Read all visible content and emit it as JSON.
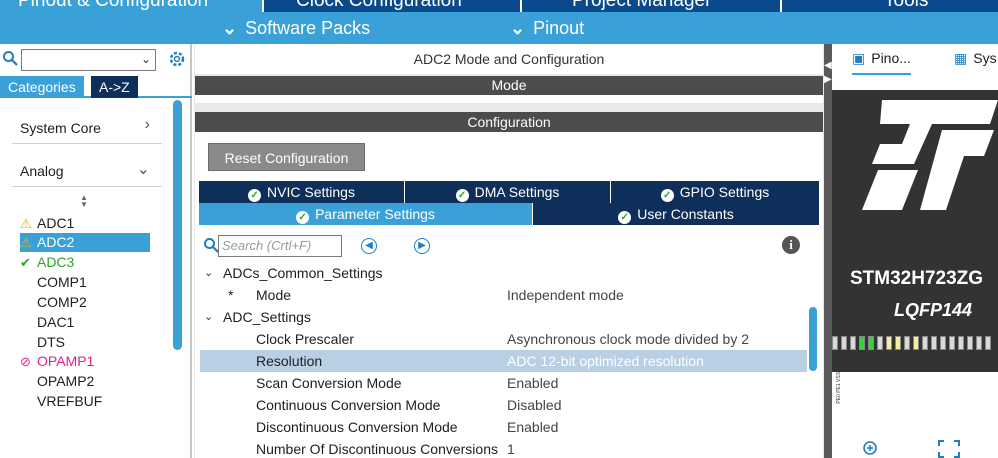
{
  "top_tabs": [
    {
      "label": "Pinout & Configuration"
    },
    {
      "label": "Clock Configuration"
    },
    {
      "label": "Project Manager"
    },
    {
      "label": "Tools"
    }
  ],
  "sub_bar": {
    "software_packs": "Software Packs",
    "pinout": "Pinout"
  },
  "left": {
    "tab_categories": "Categories",
    "tab_az": "A->Z",
    "groups": [
      {
        "label": "System Core"
      },
      {
        "label": "Analog"
      }
    ],
    "peripherals": [
      {
        "label": "ADC1",
        "status": "warning"
      },
      {
        "label": "ADC2",
        "status": "warning",
        "selected": true
      },
      {
        "label": "ADC3",
        "status": "ok"
      },
      {
        "label": "COMP1",
        "status": "none"
      },
      {
        "label": "COMP2",
        "status": "none"
      },
      {
        "label": "DAC1",
        "status": "none"
      },
      {
        "label": "DTS",
        "status": "none"
      },
      {
        "label": "OPAMP1",
        "status": "conflict"
      },
      {
        "label": "OPAMP2",
        "status": "none"
      },
      {
        "label": "VREFBUF",
        "status": "none"
      }
    ]
  },
  "middle": {
    "title": "ADC2 Mode and Configuration",
    "mode_label": "Mode",
    "configuration_label": "Configuration",
    "reset_button": "Reset Configuration",
    "tabs_row1": [
      {
        "label": "NVIC Settings"
      },
      {
        "label": "DMA Settings"
      },
      {
        "label": "GPIO Settings"
      }
    ],
    "tabs_row2": [
      {
        "label": "Parameter Settings",
        "active": true
      },
      {
        "label": "User Constants"
      }
    ],
    "search_placeholder": "Search (Crtl+F)",
    "params": [
      {
        "type": "group",
        "label": "ADCs_Common_Settings"
      },
      {
        "type": "param",
        "marker": "*",
        "name": "Mode",
        "value": "Independent mode"
      },
      {
        "type": "group",
        "label": "ADC_Settings"
      },
      {
        "type": "param",
        "name": "Clock Prescaler",
        "value": "Asynchronous clock mode divided by 2"
      },
      {
        "type": "param",
        "name": "Resolution",
        "value": "ADC 12-bit optimized resolution",
        "selected": true
      },
      {
        "type": "param",
        "name": "Scan Conversion Mode",
        "value": "Enabled"
      },
      {
        "type": "param",
        "name": "Continuous Conversion Mode",
        "value": "Disabled"
      },
      {
        "type": "param",
        "name": "Discontinuous Conversion Mode",
        "value": "Enabled"
      },
      {
        "type": "param",
        "name": "Number Of Discontinuous Conversions",
        "value": "1"
      }
    ]
  },
  "right": {
    "tab_pinout": "Pino...",
    "tab_system": "Sys",
    "chip_name": "STM32H723ZG",
    "package": "LQFP144",
    "pin_labels": "PE0 PE1 VSS VDD"
  },
  "colors": {
    "accent": "#3aa0d8",
    "dark_navy": "#0e2f5a",
    "warning": "#e8b400",
    "ok": "#2aa82a",
    "conflict": "#e0208a"
  }
}
